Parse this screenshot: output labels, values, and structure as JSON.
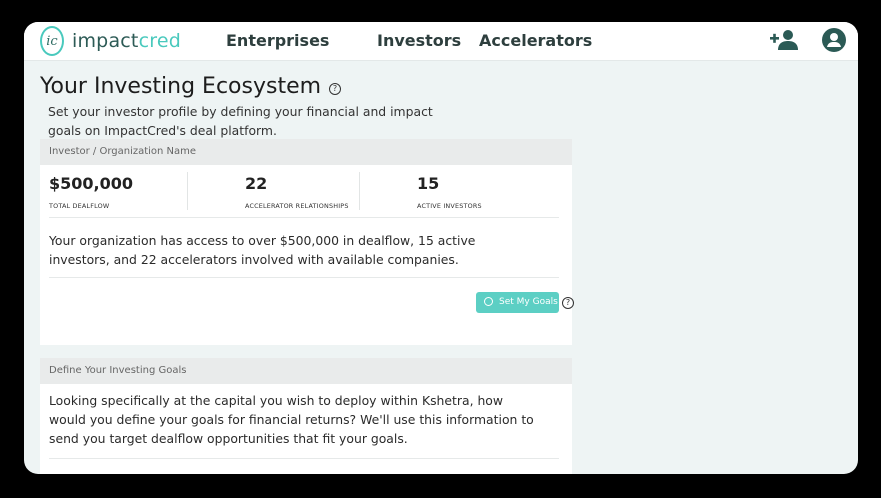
{
  "nav": {
    "logo_part1": "impact",
    "logo_part2": "cred",
    "logo_mark": "ic",
    "links": [
      "Enterprises",
      "Investors",
      "Accelerators"
    ],
    "icons": [
      "add-user-icon",
      "account-icon"
    ]
  },
  "page": {
    "title": "Your Investing Ecosystem",
    "intro": "Set your investor profile by defining your financial and impact goals on ImpactCred's deal platform."
  },
  "org_card": {
    "header": "Investor / Organization Name",
    "stats": [
      {
        "value": "$500,000",
        "label": "TOTAL DEALFLOW"
      },
      {
        "value": "22",
        "label": "ACCELERATOR RELATIONSHIPS"
      },
      {
        "value": "15",
        "label": "ACTIVE INVESTORS"
      }
    ],
    "summary": "Your organization has access to over $500,000 in dealflow, 15 active investors, and 22 accelerators involved with available companies.",
    "button_label": "Set My Goals"
  },
  "goals_card": {
    "header": "Define Your Investing Goals",
    "body": "Looking specifically at the capital you wish to deploy within Kshetra, how would you define your goals for financial returns? We'll use this information to send you target dealflow opportunities that fit your goals."
  },
  "colors": {
    "accent": "#5ccfc4",
    "logo_dark": "#2d5b56",
    "background": "#eef4f4"
  }
}
